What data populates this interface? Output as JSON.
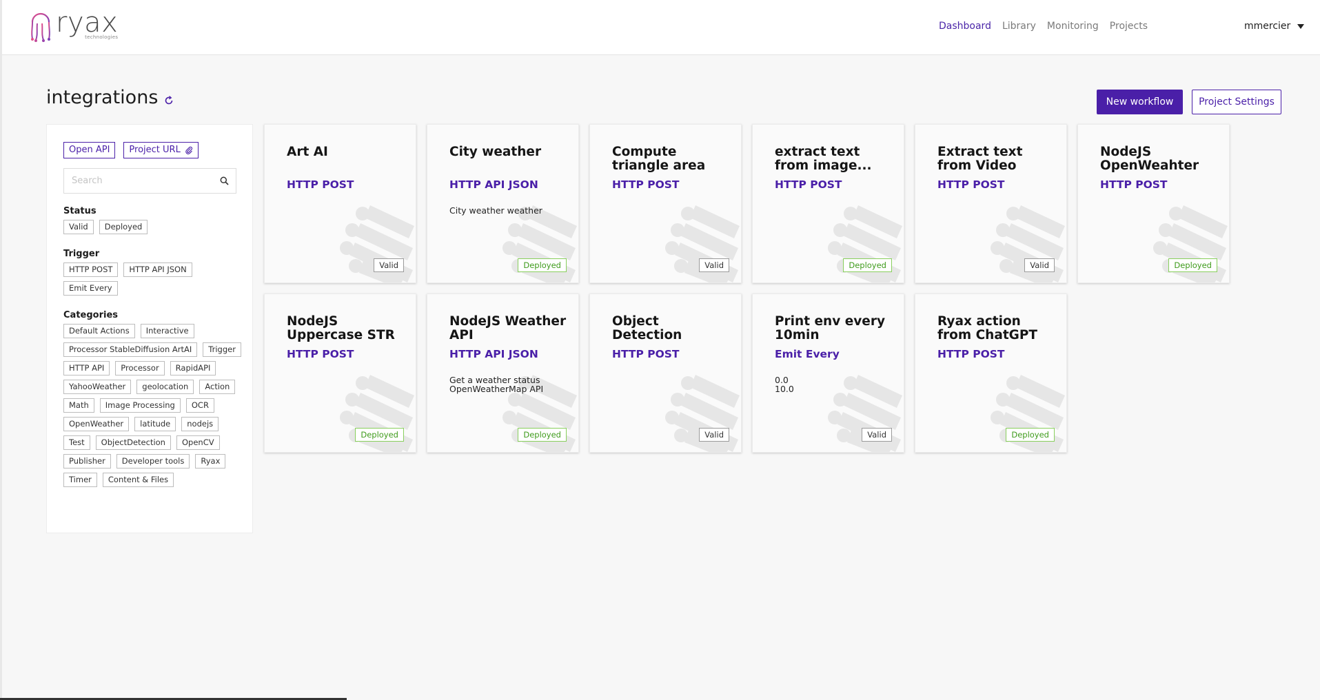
{
  "colors": {
    "accent": "#4a1fa8",
    "deployed": "#3f9b1c"
  },
  "logo": {
    "word": "ryax",
    "sub": "technologies"
  },
  "nav": {
    "items": [
      "Dashboard",
      "Library",
      "Monitoring",
      "Projects"
    ],
    "active": "Dashboard"
  },
  "user": {
    "name": "mmercier"
  },
  "page": {
    "title": "integrations",
    "title_icon": "refresh-icon"
  },
  "buttons": {
    "new_workflow": "New workflow",
    "project_settings": "Project Settings"
  },
  "sidebar": {
    "open_api": "Open API",
    "project_url": "Project URL",
    "search_placeholder": "Search",
    "status": {
      "title": "Status",
      "chips": [
        "Valid",
        "Deployed"
      ]
    },
    "trigger": {
      "title": "Trigger",
      "chips": [
        "HTTP POST",
        "HTTP API JSON",
        "Emit Every"
      ]
    },
    "categories": {
      "title": "Categories",
      "chips": [
        "Default Actions",
        "Interactive",
        "Processor StableDiffusion ArtAI",
        "Trigger",
        "HTTP API",
        "Processor",
        "RapidAPI",
        "YahooWeather",
        "geolocation",
        "Action",
        "Math",
        "Image Processing",
        "OCR",
        "OpenWeather",
        "latitude",
        "nodejs",
        "Test",
        "ObjectDetection",
        "OpenCV",
        "Publisher",
        "Developer tools",
        "Ryax",
        "Timer",
        "Content & Files"
      ]
    }
  },
  "workflows": [
    {
      "title": "Art AI",
      "trigger": "HTTP POST",
      "desc": "",
      "status": "Valid"
    },
    {
      "title": "City weather",
      "trigger": "HTTP API JSON",
      "desc": "City weather weather",
      "status": "Deployed"
    },
    {
      "title": "Compute triangle area",
      "trigger": "HTTP POST",
      "desc": "",
      "status": "Valid"
    },
    {
      "title": "extract text from image...",
      "trigger": "HTTP POST",
      "desc": "",
      "status": "Deployed"
    },
    {
      "title": "Extract text from Video",
      "trigger": "HTTP POST",
      "desc": "",
      "status": "Valid"
    },
    {
      "title": "NodeJS OpenWeahter",
      "trigger": "HTTP POST",
      "desc": "",
      "status": "Deployed"
    },
    {
      "title": "NodeJS Uppercase STR",
      "trigger": "HTTP POST",
      "desc": "",
      "status": "Deployed"
    },
    {
      "title": "NodeJS Weather API",
      "trigger": "HTTP API JSON",
      "desc": "Get a weather status OpenWeatherMap API",
      "status": "Deployed"
    },
    {
      "title": "Object Detection",
      "trigger": "HTTP POST",
      "desc": "",
      "status": "Valid"
    },
    {
      "title": "Print env every 10min",
      "trigger": "Emit Every",
      "desc": "0.0\n10.0",
      "status": "Valid"
    },
    {
      "title": "Ryax action from ChatGPT",
      "trigger": "HTTP POST",
      "desc": "",
      "status": "Deployed"
    }
  ]
}
